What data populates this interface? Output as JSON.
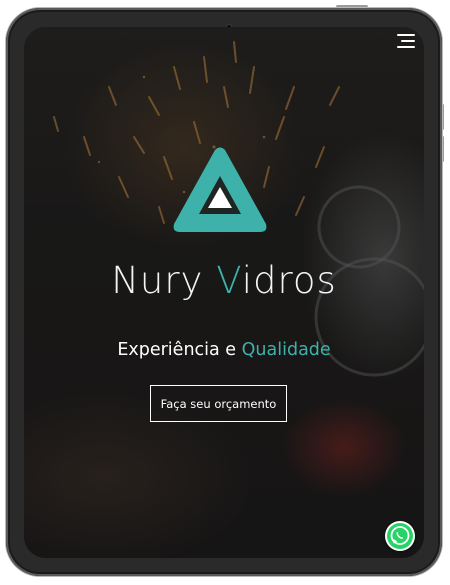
{
  "brand": {
    "prefix": "Nury ",
    "accent": "V",
    "suffix": "idros"
  },
  "tagline": {
    "first": "Experiência e ",
    "highlight": "Qualidade"
  },
  "cta": {
    "label": "Faça seu orçamento"
  },
  "icons": {
    "menu": "hamburger-menu-icon",
    "chat": "whatsapp-icon",
    "logo": "triangle-logo"
  },
  "colors": {
    "accent": "#3eb2aa",
    "text": "#ffffff",
    "whatsapp": "#25d366"
  }
}
